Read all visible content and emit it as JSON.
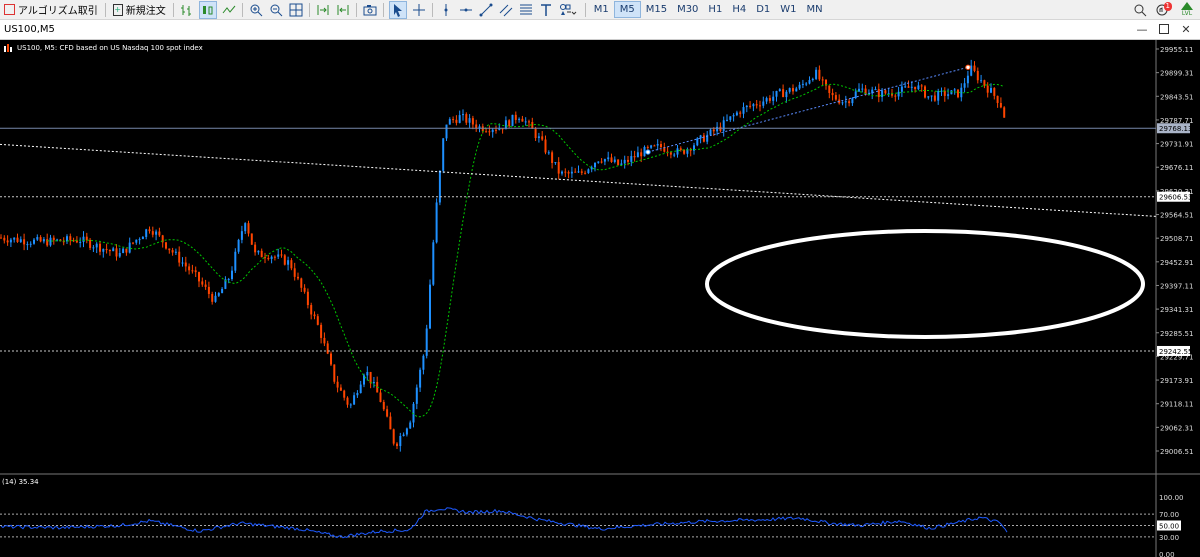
{
  "toolbar": {
    "algo_label": "アルゴリズム取引",
    "new_order_label": "新規注文",
    "timeframes": [
      "M1",
      "M5",
      "M15",
      "M30",
      "H1",
      "H4",
      "D1",
      "W1",
      "MN"
    ],
    "active_timeframe": "M5",
    "notification_count": "1",
    "lvl_label": "LVL"
  },
  "window": {
    "title": "US100,M5"
  },
  "chart": {
    "symbol_desc": "US100, M5:  CFD based on US Nasdaq 100 spot index",
    "price_axis": [
      "29955.11",
      "29899.31",
      "29843.51",
      "29787.71",
      "29731.91",
      "29676.11",
      "29620.31",
      "29564.51",
      "29508.71",
      "29452.91",
      "29397.11",
      "29341.31",
      "29285.51",
      "29229.71",
      "29173.91",
      "29118.11",
      "29062.31",
      "29006.51"
    ],
    "current_price": "29768.13",
    "hline_upper": "29606.53",
    "hline_lower": "29242.55",
    "colors": {
      "bull": "#1e90ff",
      "bear": "#ff4500",
      "ma": "#00c800",
      "grid_line": "#c8c8c8",
      "rsi": "#1e5aff"
    },
    "annotation": "white-ellipse"
  },
  "indicator": {
    "label": "(14) 35.34",
    "axis": [
      "100.00",
      "70.00",
      "50.00",
      "30.00",
      "0.00"
    ],
    "current": "50.00"
  },
  "chart_data": {
    "type": "candlestick",
    "symbol": "US100",
    "timeframe": "M5",
    "ylim": [
      29006.51,
      29955.11
    ],
    "close_path": [
      [
        0,
        29510
      ],
      [
        40,
        29500
      ],
      [
        80,
        29505
      ],
      [
        120,
        29470
      ],
      [
        150,
        29535
      ],
      [
        175,
        29470
      ],
      [
        195,
        29420
      ],
      [
        215,
        29360
      ],
      [
        230,
        29420
      ],
      [
        245,
        29555
      ],
      [
        255,
        29470
      ],
      [
        270,
        29470
      ],
      [
        290,
        29450
      ],
      [
        305,
        29370
      ],
      [
        320,
        29290
      ],
      [
        335,
        29170
      ],
      [
        350,
        29110
      ],
      [
        365,
        29200
      ],
      [
        380,
        29130
      ],
      [
        395,
        29020
      ],
      [
        410,
        29080
      ],
      [
        425,
        29250
      ],
      [
        435,
        29550
      ],
      [
        445,
        29780
      ],
      [
        460,
        29795
      ],
      [
        480,
        29770
      ],
      [
        500,
        29770
      ],
      [
        520,
        29800
      ],
      [
        540,
        29740
      ],
      [
        560,
        29660
      ],
      [
        580,
        29660
      ],
      [
        600,
        29700
      ],
      [
        620,
        29680
      ],
      [
        640,
        29710
      ],
      [
        660,
        29725
      ],
      [
        680,
        29710
      ],
      [
        700,
        29740
      ],
      [
        720,
        29770
      ],
      [
        740,
        29810
      ],
      [
        760,
        29830
      ],
      [
        780,
        29850
      ],
      [
        800,
        29865
      ],
      [
        815,
        29900
      ],
      [
        830,
        29845
      ],
      [
        845,
        29830
      ],
      [
        860,
        29860
      ],
      [
        880,
        29850
      ],
      [
        900,
        29855
      ],
      [
        915,
        29870
      ],
      [
        930,
        29840
      ],
      [
        945,
        29850
      ],
      [
        960,
        29850
      ],
      [
        970,
        29910
      ],
      [
        985,
        29870
      ],
      [
        1000,
        29830
      ],
      [
        1008,
        29768
      ]
    ],
    "rsi_path": [
      [
        0,
        48
      ],
      [
        60,
        46
      ],
      [
        120,
        50
      ],
      [
        150,
        58
      ],
      [
        200,
        40
      ],
      [
        240,
        54
      ],
      [
        300,
        44
      ],
      [
        340,
        30
      ],
      [
        380,
        40
      ],
      [
        410,
        42
      ],
      [
        425,
        74
      ],
      [
        440,
        80
      ],
      [
        470,
        73
      ],
      [
        500,
        76
      ],
      [
        540,
        60
      ],
      [
        570,
        52
      ],
      [
        600,
        44
      ],
      [
        640,
        50
      ],
      [
        700,
        57
      ],
      [
        760,
        60
      ],
      [
        800,
        63
      ],
      [
        830,
        54
      ],
      [
        860,
        50
      ],
      [
        900,
        58
      ],
      [
        930,
        45
      ],
      [
        960,
        56
      ],
      [
        980,
        64
      ],
      [
        1000,
        55
      ],
      [
        1008,
        35
      ]
    ]
  }
}
